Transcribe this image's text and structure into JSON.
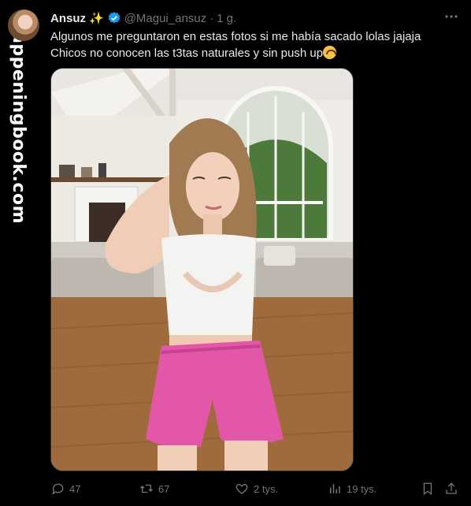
{
  "watermark": {
    "text": "fappeningbook.com"
  },
  "tweet": {
    "display_name": "Ansuz",
    "name_emoji": "✨",
    "handle": "@Magui_ansuz",
    "separator": "·",
    "time": "1 g.",
    "more_icon": "more-horizontal-icon",
    "text_line1": "Algunos me preguntaron en estas fotos si me había sacado lolas jajaja",
    "text_line2": "Chicos no conocen las t3tas naturales y sin push up"
  },
  "actions": {
    "reply_count": "47",
    "retweet_count": "67",
    "like_count": "2 tys.",
    "views_count": "19 tys."
  },
  "colors": {
    "background": "#000000",
    "text": "#e7e9ea",
    "muted": "#71767b",
    "verified": "#1d9bf0",
    "border": "#2f3336"
  }
}
